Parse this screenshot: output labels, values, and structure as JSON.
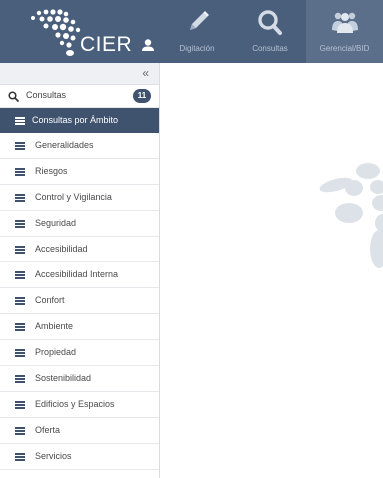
{
  "app": {
    "logo_text": "CIER",
    "logo_icon": "user-icon"
  },
  "nav": [
    {
      "label": "Digitación",
      "icon": "pencil-icon"
    },
    {
      "label": "Consultas",
      "icon": "search-icon"
    },
    {
      "label": "Gerencial/BID",
      "icon": "users-icon"
    }
  ],
  "sidebar": {
    "collapse_glyph": "«",
    "consultas": {
      "label": "Consultas",
      "count": "11"
    },
    "active": {
      "label": "Consultas por Ámbito"
    },
    "items": [
      {
        "label": "Generalidades"
      },
      {
        "label": "Riesgos"
      },
      {
        "label": "Control y Vigilancia"
      },
      {
        "label": "Seguridad"
      },
      {
        "label": "Accesibilidad"
      },
      {
        "label": "Accesibilidad Interna"
      },
      {
        "label": "Confort"
      },
      {
        "label": "Ambiente"
      },
      {
        "label": "Propiedad"
      },
      {
        "label": "Sostenibilidad"
      },
      {
        "label": "Edificios y Espacios"
      },
      {
        "label": "Oferta"
      },
      {
        "label": "Servicios"
      }
    ]
  },
  "colors": {
    "topbar": "#4a5f7c",
    "active_nav": "#5b6f8b",
    "active_item": "#3f536f",
    "decor_shape": "#dde2e9"
  }
}
